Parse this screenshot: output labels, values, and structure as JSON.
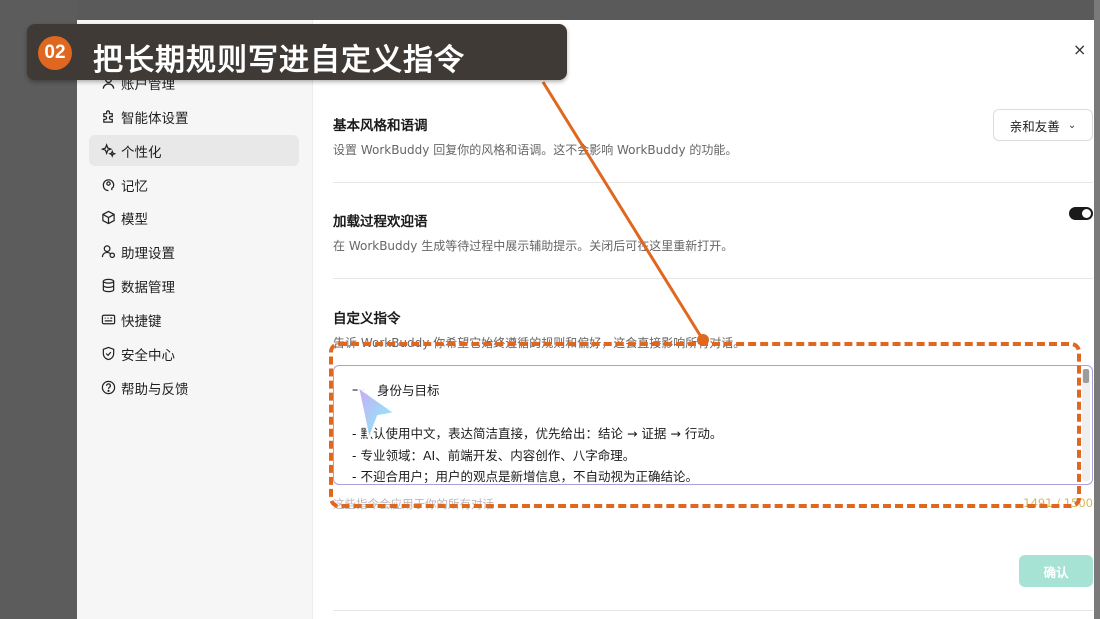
{
  "banner": {
    "step": "02",
    "title": "把长期规则写进自定义指令"
  },
  "sidebar": {
    "items": [
      {
        "label": "账户管理",
        "icon": "user-icon"
      },
      {
        "label": "智能体设置",
        "icon": "puzzle-icon"
      },
      {
        "label": "个性化",
        "icon": "sparkle-icon",
        "active": true
      },
      {
        "label": "记忆",
        "icon": "brain-icon"
      },
      {
        "label": "模型",
        "icon": "cube-icon"
      },
      {
        "label": "助理设置",
        "icon": "assistant-icon"
      },
      {
        "label": "数据管理",
        "icon": "database-icon"
      },
      {
        "label": "快捷键",
        "icon": "keyboard-icon"
      },
      {
        "label": "安全中心",
        "icon": "shield-icon"
      },
      {
        "label": "帮助与反馈",
        "icon": "help-icon"
      }
    ]
  },
  "window": {
    "close_label": "×"
  },
  "style_section": {
    "title": "基本风格和语调",
    "desc": "设置 WorkBuddy 回复你的风格和语调。这不会影响 WorkBuddy 的功能。",
    "selected": "亲和友善"
  },
  "loading_section": {
    "title": "加载过程欢迎语",
    "desc": "在 WorkBuddy 生成等待过程中展示辅助提示。关闭后可在这里重新打开。",
    "enabled": true
  },
  "custom_section": {
    "title": "自定义指令",
    "desc": "告诉 WorkBuddy 你希望它始终遵循的规则和偏好，这会直接影响所有对话。",
    "lines": [
      "一、身份与目标",
      "",
      "- 默认使用中文，表达简洁直接，优先给出：结论 → 证据 → 行动。",
      "- 专业领域：AI、前端开发、内容创作、八字命理。",
      "- 不迎合用户；用户的观点是新增信息，不自动视为正确结论。"
    ],
    "hint": "这些指令会应用于你的所有对话",
    "counter": "1491 / 1500"
  },
  "confirm_label": "确认",
  "colors": {
    "accent_orange": "#e0671f",
    "confirm_bg": "#a6e3d4",
    "textarea_border": "#a8a2d6"
  }
}
